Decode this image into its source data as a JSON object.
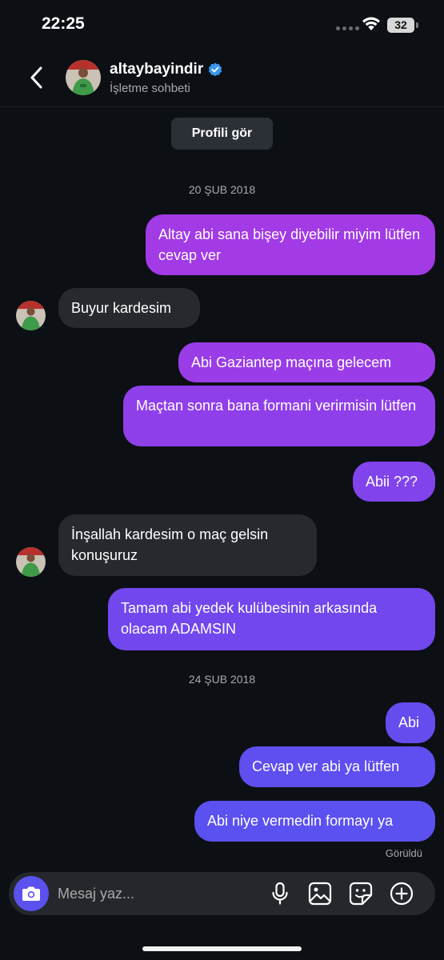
{
  "status": {
    "time": "22:25",
    "battery": "32"
  },
  "header": {
    "name": "altaybayindir",
    "subtitle": "İşletme sohbeti"
  },
  "profile_button": "Profili gör",
  "dates": [
    "20 ŞUB 2018",
    "24 ŞUB 2018"
  ],
  "messages": [
    {
      "dir": "out",
      "text": "Altay abi sana bişey diyebilir miyim lütfen cevap ver"
    },
    {
      "dir": "in",
      "text": "Buyur kardesim"
    },
    {
      "dir": "out",
      "text": "Abi Gaziantep maçına gelecem"
    },
    {
      "dir": "out",
      "text": "Maçtan sonra bana formani verirmisin lütfen"
    },
    {
      "dir": "out",
      "text": "Abii ???"
    },
    {
      "dir": "in",
      "text": "İnşallah kardesim o maç gelsin konuşuruz"
    },
    {
      "dir": "out",
      "text": "Tamam abi yedek kulübesinin arkasında olacam ADAMSIN"
    },
    {
      "dir": "out",
      "text": "Abi"
    },
    {
      "dir": "out",
      "text": "Cevap ver abi ya lütfen"
    },
    {
      "dir": "out",
      "text": "Abi niye vermedin formayı ya"
    }
  ],
  "seen": "Görüldü",
  "composer": {
    "placeholder": "Mesaj yaz..."
  },
  "colors": {
    "background": "#0c1014",
    "incoming_bubble": "#262a2f",
    "outgoing_top": "#a23ae6",
    "outgoing_bottom": "#5b51f0",
    "verified": "#3897f0"
  },
  "icons": [
    "back-chevron-icon",
    "verified-badge-icon",
    "camera-icon",
    "microphone-icon",
    "gallery-icon",
    "sticker-icon",
    "plus-icon"
  ]
}
